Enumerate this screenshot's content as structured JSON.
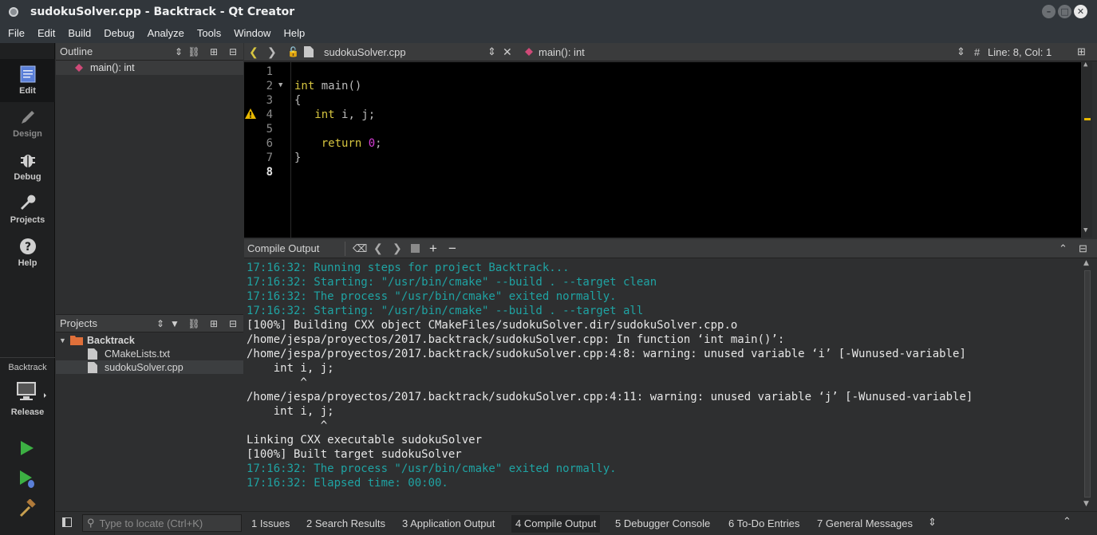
{
  "window": {
    "title": "sudokuSolver.cpp - Backtrack - Qt Creator"
  },
  "menu": [
    "File",
    "Edit",
    "Build",
    "Debug",
    "Analyze",
    "Tools",
    "Window",
    "Help"
  ],
  "modes": [
    {
      "label": "Edit",
      "icon": "edit-icon",
      "active": true
    },
    {
      "label": "Design",
      "icon": "design-icon",
      "active": false
    },
    {
      "label": "Debug",
      "icon": "debug-icon",
      "active": false
    },
    {
      "label": "Projects",
      "icon": "projects-icon",
      "active": false
    },
    {
      "label": "Help",
      "icon": "help-icon",
      "active": false
    }
  ],
  "kit": {
    "project": "Backtrack",
    "build_mode": "Release"
  },
  "outline": {
    "title": "Outline",
    "items": [
      "main(): int"
    ]
  },
  "projects": {
    "title": "Projects",
    "root": "Backtrack",
    "files": [
      "CMakeLists.txt",
      "sudokuSolver.cpp"
    ],
    "selected": "sudokuSolver.cpp"
  },
  "editor_toolbar": {
    "file": "sudokuSolver.cpp",
    "symbol": "main(): int",
    "hash": "#",
    "position": "Line: 8, Col: 1"
  },
  "editor": {
    "current_line": 8,
    "warning_line": 4,
    "lines": [
      {
        "n": "1",
        "text": ""
      },
      {
        "n": "2",
        "kw": "int",
        "rest": " main()"
      },
      {
        "n": "3",
        "text": "{"
      },
      {
        "n": "4",
        "indent": "   ",
        "kw": "int",
        "rest": " i, j;"
      },
      {
        "n": "5",
        "text": ""
      },
      {
        "n": "6",
        "indent": "    ",
        "kw": "return",
        "sp": " ",
        "num": "0",
        "tail": ";"
      },
      {
        "n": "7",
        "text": "}"
      },
      {
        "n": "8",
        "text": ""
      }
    ]
  },
  "compile_output": {
    "title": "Compile Output",
    "lines": [
      {
        "t": "17:16:32: Running steps for project Backtrack...",
        "info": true
      },
      {
        "t": "17:16:32: Starting: \"/usr/bin/cmake\" --build . --target clean",
        "info": true
      },
      {
        "t": "17:16:32: The process \"/usr/bin/cmake\" exited normally.",
        "info": true
      },
      {
        "t": "17:16:32: Starting: \"/usr/bin/cmake\" --build . --target all",
        "info": true
      },
      {
        "t": "[100%] Building CXX object CMakeFiles/sudokuSolver.dir/sudokuSolver.cpp.o",
        "info": false
      },
      {
        "t": "/home/jespa/proyectos/2017.backtrack/sudokuSolver.cpp: In function ‘int main()’:",
        "info": false
      },
      {
        "t": "/home/jespa/proyectos/2017.backtrack/sudokuSolver.cpp:4:8: warning: unused variable ‘i’ [-Wunused-variable]",
        "info": false
      },
      {
        "t": "    int i, j;",
        "info": false
      },
      {
        "t": "        ^",
        "info": false
      },
      {
        "t": "/home/jespa/proyectos/2017.backtrack/sudokuSolver.cpp:4:11: warning: unused variable ‘j’ [-Wunused-variable]",
        "info": false
      },
      {
        "t": "    int i, j;",
        "info": false
      },
      {
        "t": "           ^",
        "info": false
      },
      {
        "t": "Linking CXX executable sudokuSolver",
        "info": false
      },
      {
        "t": "[100%] Built target sudokuSolver",
        "info": false
      },
      {
        "t": "17:16:32: The process \"/usr/bin/cmake\" exited normally.",
        "info": true
      },
      {
        "t": "17:16:32: Elapsed time: 00:00.",
        "info": true
      }
    ]
  },
  "statusbar": {
    "locator_placeholder": "Type to locate (Ctrl+K)",
    "tabs": [
      {
        "num": "1",
        "label": "Issues"
      },
      {
        "num": "2",
        "label": "Search Results"
      },
      {
        "num": "3",
        "label": "Application Output"
      },
      {
        "num": "4",
        "label": "Compile Output",
        "active": true
      },
      {
        "num": "5",
        "label": "Debugger Console"
      },
      {
        "num": "6",
        "label": "To-Do Entries"
      },
      {
        "num": "7",
        "label": "General Messages"
      }
    ]
  },
  "colors": {
    "info": "#1fa3a3",
    "keyword": "#d6c540",
    "number": "#d63cd6",
    "run": "#3cb043"
  }
}
